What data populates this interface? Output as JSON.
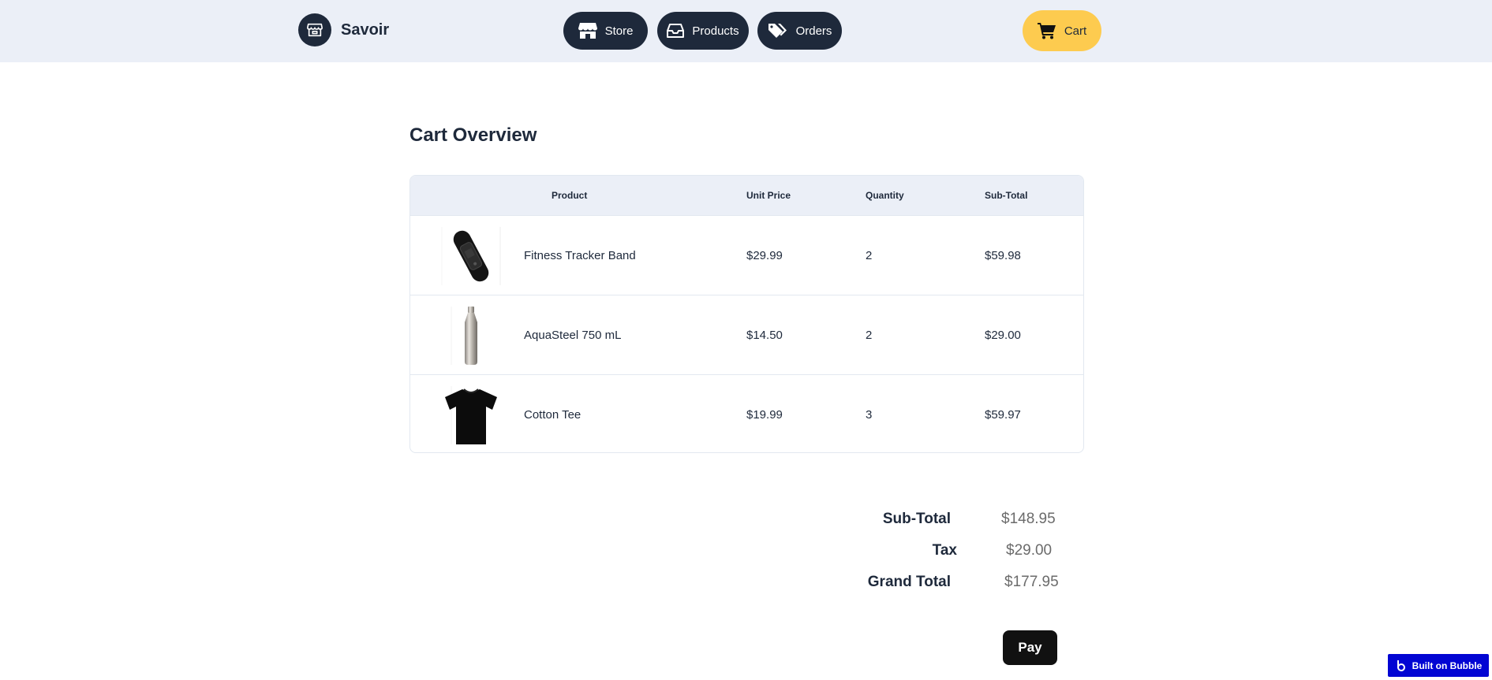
{
  "header": {
    "brand": {
      "name": "Savoir",
      "icon": "store-icon"
    },
    "nav": [
      {
        "label": "Store",
        "icon": "storefront-icon"
      },
      {
        "label": "Products",
        "icon": "inbox-tray-icon"
      },
      {
        "label": "Orders",
        "icon": "tags-icon"
      }
    ],
    "cart": {
      "label": "Cart",
      "icon": "shopping-cart-icon"
    }
  },
  "colors": {
    "header_bg": "#ebeff7",
    "nav_bg": "#1e293b",
    "cart_bg": "#fdcb4f",
    "pay_bg": "#111111",
    "badge_bg": "#0205d3"
  },
  "main": {
    "title": "Cart Overview",
    "table": {
      "columns": [
        "Product",
        "Unit Price",
        "Quantity",
        "Sub-Total"
      ],
      "rows": [
        {
          "name": "Fitness Tracker Band",
          "unit_price": "$29.99",
          "quantity": "2",
          "subtotal": "$59.98",
          "image": "fitness-band-image"
        },
        {
          "name": "AquaSteel 750 mL",
          "unit_price": "$14.50",
          "quantity": "2",
          "subtotal": "$29.00",
          "image": "steel-bottle-image"
        },
        {
          "name": "Cotton Tee",
          "unit_price": "$19.99",
          "quantity": "3",
          "subtotal": "$59.97",
          "image": "black-tshirt-image"
        }
      ]
    },
    "totals": {
      "subtotal_label": "Sub-Total",
      "subtotal_value": "$148.95",
      "tax_label": "Tax",
      "tax_value": "$29.00",
      "grand_label": "Grand Total",
      "grand_value": "$177.95"
    },
    "pay_label": "Pay"
  },
  "badge": {
    "label": "Built on Bubble"
  }
}
